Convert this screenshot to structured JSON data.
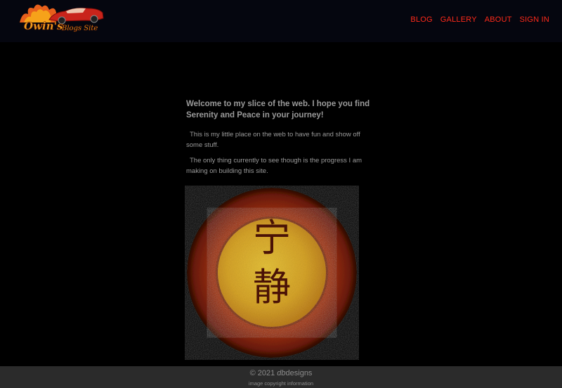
{
  "header": {
    "logo_text": "Owin's Blogs Site",
    "nav": [
      "BLOG",
      "GALLERY",
      "ABOUT",
      "SIGN IN"
    ]
  },
  "main": {
    "headline": "Welcome to my slice of the web. I hope you find Serenity and Peace in your journey!",
    "paragraphs": [
      "This is my little place on the web to have fun and show off some stuff.",
      "The only thing currently to see though is the progress I am making on building this site."
    ],
    "emblem_characters": [
      "宁",
      "静"
    ]
  },
  "footer": {
    "copyright_prefix": "© 2021 ",
    "copyright_brand": "db",
    "copyright_suffix": "designs",
    "image_info": "image copyright information"
  },
  "colors": {
    "header_bg": "#05060f",
    "nav_link": "#ff2a1a",
    "body_text": "#9a9a9a",
    "footer_bg": "#2b2b2b"
  }
}
